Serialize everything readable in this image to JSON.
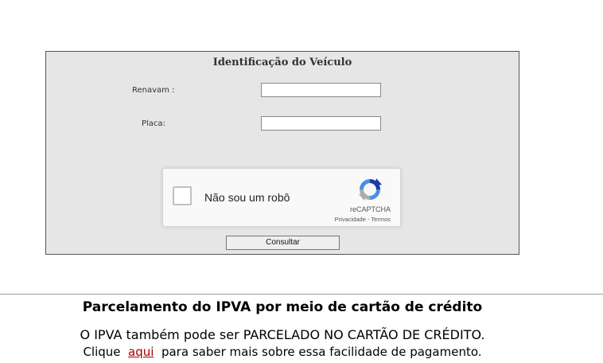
{
  "form": {
    "title": "Identificação do Veículo",
    "renavam_label": "Renavam :",
    "renavam_value": "",
    "placa_label": "Placa:",
    "placa_value": "",
    "submit_label": "Consultar"
  },
  "recaptcha": {
    "checkbox_label": "Não sou um robô",
    "brand": "reCAPTCHA",
    "privacy_link": "Privacidade",
    "separator": " - ",
    "terms_link": "Termos",
    "logo_icon": "recaptcha-logo-icon"
  },
  "installment": {
    "title": "Parcelamento do IPVA por meio de cartão de crédito",
    "line1": "O IPVA também pode ser PARCELADO NO CARTÃO DE CRÉDITO.",
    "line2_prefix": "Clique  ",
    "link_text": "aqui",
    "line2_suffix": "  para saber mais sobre essa facilidade de pagamento.",
    "link_color": "#a30000"
  }
}
